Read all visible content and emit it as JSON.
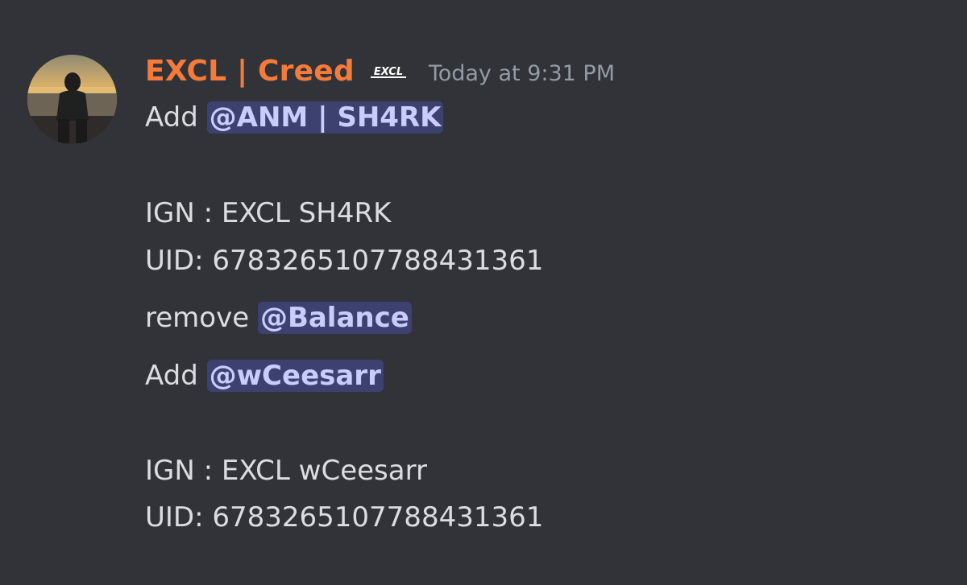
{
  "message": {
    "author": "EXCL | Creed",
    "badge_icon": "excl-logo-icon",
    "badge_text": "EXCL",
    "timestamp": "Today at 9:31 PM",
    "author_color": "#f47b3a",
    "mention_color": "#c9cdfb",
    "lines": [
      {
        "prefix": "Add",
        "mention": "@ANM | SH4RK"
      },
      {
        "text": "IGN : EXCL SH4RK"
      },
      {
        "text": "UID: 6783265107788431361"
      },
      {
        "prefix": "remove",
        "mention": "@Balance"
      },
      {
        "prefix": "Add",
        "mention": "@wCeesarr"
      },
      {
        "text": "IGN : EXCL wCeesarr"
      },
      {
        "text": "UID: 6783265107788431361"
      }
    ]
  }
}
